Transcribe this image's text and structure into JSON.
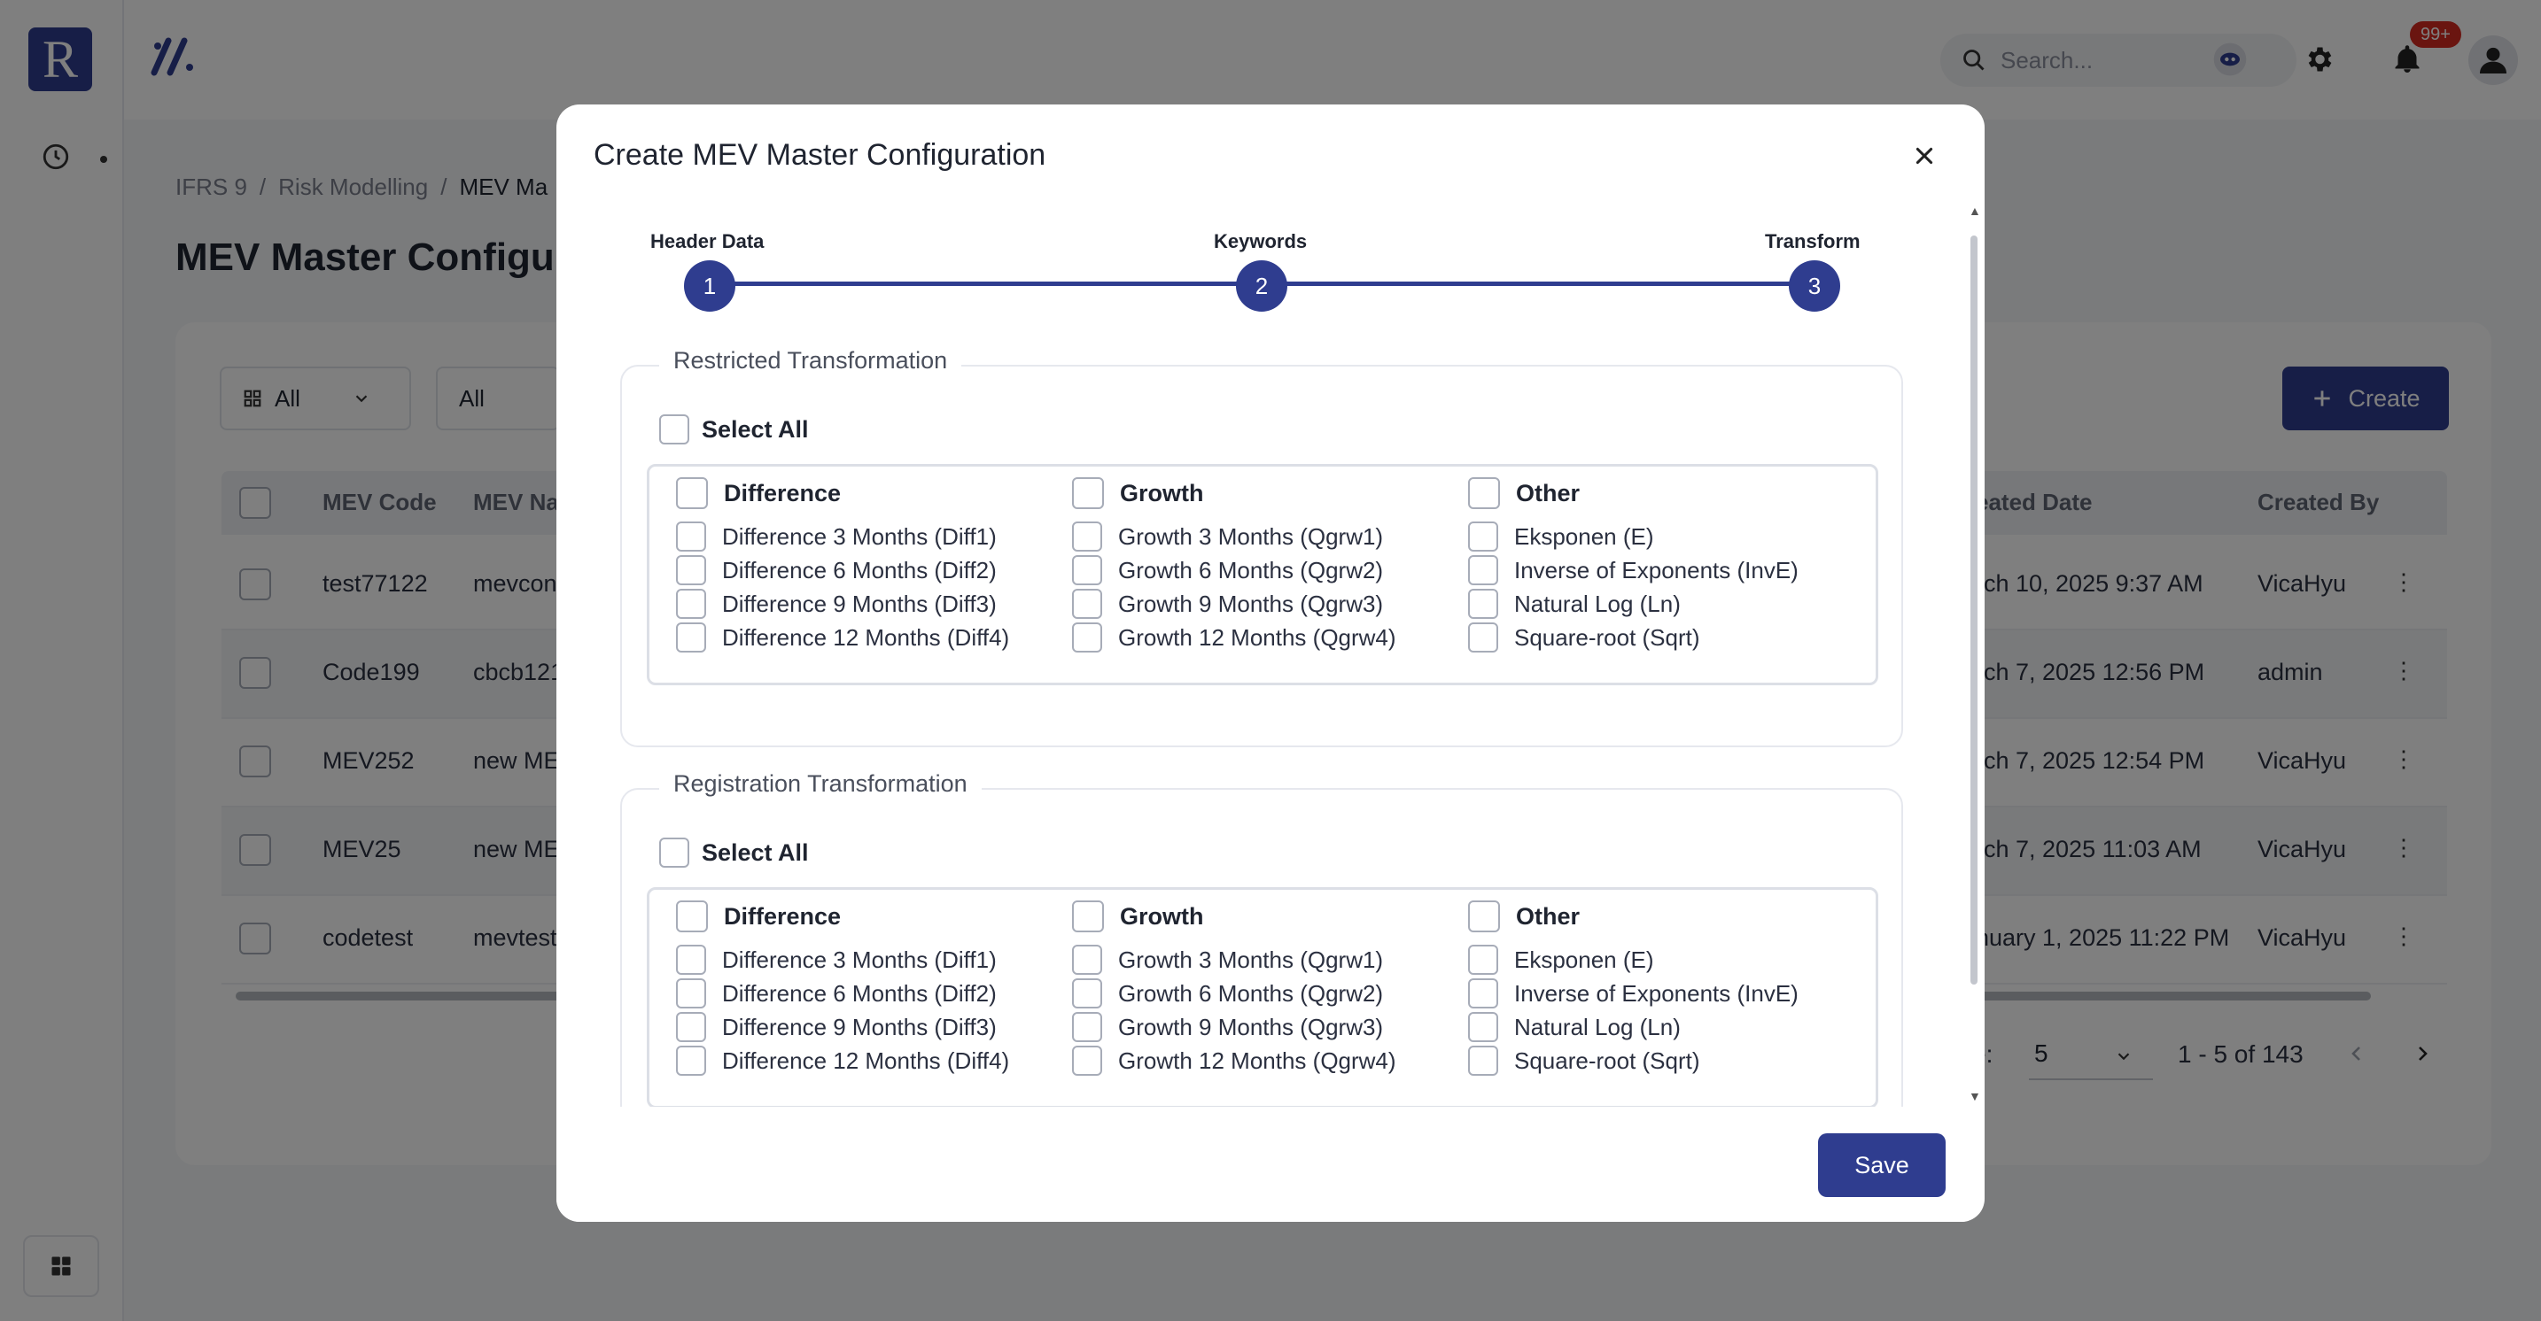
{
  "app": {
    "logo_letter": "R",
    "search_placeholder": "Search...",
    "notification_count": "99+"
  },
  "breadcrumb": [
    "IFRS 9",
    "Risk Modelling",
    "MEV Ma"
  ],
  "page_title": "MEV Master Configu",
  "filters": {
    "first": "All",
    "second": "All"
  },
  "create_label": "Create",
  "table": {
    "headers": [
      "MEV Code",
      "MEV Na",
      "eated Date",
      "Created By"
    ],
    "rows": [
      {
        "code": "test77122",
        "name": "mevcon",
        "date": "rch 10, 2025 9:37 AM",
        "by": "VicaHyu"
      },
      {
        "code": "Code199",
        "name": "cbcb121",
        "date": "rch 7, 2025 12:56 PM",
        "by": "admin"
      },
      {
        "code": "MEV252",
        "name": "new ME",
        "date": "rch 7, 2025 12:54 PM",
        "by": "VicaHyu"
      },
      {
        "code": "MEV25",
        "name": "new ME",
        "date": "rch 7, 2025 11:03 AM",
        "by": "VicaHyu"
      },
      {
        "code": "codetest",
        "name": "mevtest",
        "date": "nuary 1, 2025 11:22 PM",
        "by": "VicaHyu"
      }
    ]
  },
  "pagination": {
    "rows_label": "e:",
    "rows_value": "5",
    "range": "1 - 5 of 143"
  },
  "modal": {
    "title": "Create MEV Master Configuration",
    "steps": [
      {
        "number": "1",
        "label": "Header Data"
      },
      {
        "number": "2",
        "label": "Keywords"
      },
      {
        "number": "3",
        "label": "Transform"
      }
    ],
    "groups": [
      {
        "legend": "Restricted Transformation",
        "select_all": "Select All",
        "columns": [
          {
            "head": "Difference",
            "options": [
              "Difference 3 Months (Diff1)",
              "Difference 6 Months (Diff2)",
              "Difference 9 Months (Diff3)",
              "Difference 12 Months (Diff4)"
            ]
          },
          {
            "head": "Growth",
            "options": [
              "Growth 3 Months (Qgrw1)",
              "Growth 6 Months (Qgrw2)",
              "Growth 9 Months (Qgrw3)",
              "Growth 12 Months (Qgrw4)"
            ]
          },
          {
            "head": "Other",
            "options": [
              "Eksponen (E)",
              "Inverse of Exponents (InvE)",
              "Natural Log (Ln)",
              "Square-root (Sqrt)"
            ]
          }
        ]
      },
      {
        "legend": "Registration Transformation",
        "select_all": "Select All",
        "columns": [
          {
            "head": "Difference",
            "options": [
              "Difference 3 Months (Diff1)",
              "Difference 6 Months (Diff2)",
              "Difference 9 Months (Diff3)",
              "Difference 12 Months (Diff4)"
            ]
          },
          {
            "head": "Growth",
            "options": [
              "Growth 3 Months (Qgrw1)",
              "Growth 6 Months (Qgrw2)",
              "Growth 9 Months (Qgrw3)",
              "Growth 12 Months (Qgrw4)"
            ]
          },
          {
            "head": "Other",
            "options": [
              "Eksponen (E)",
              "Inverse of Exponents (InvE)",
              "Natural Log (Ln)",
              "Square-root (Sqrt)"
            ]
          }
        ]
      }
    ],
    "save_label": "Save"
  },
  "colors": {
    "primary": "#2f3d8f",
    "badge": "#d42b20",
    "overlay": "rgba(0,0,0,0.5)"
  },
  "icons": [
    "history-icon",
    "apps-grid-icon",
    "brand-mark-icon",
    "search-icon",
    "assistant-icon",
    "gear-icon",
    "bell-icon",
    "user-avatar-icon",
    "grid-filter-icon",
    "chevron-down-icon",
    "plus-icon",
    "kebab-menu-icon",
    "chevron-left-icon",
    "chevron-right-icon",
    "close-icon"
  ]
}
